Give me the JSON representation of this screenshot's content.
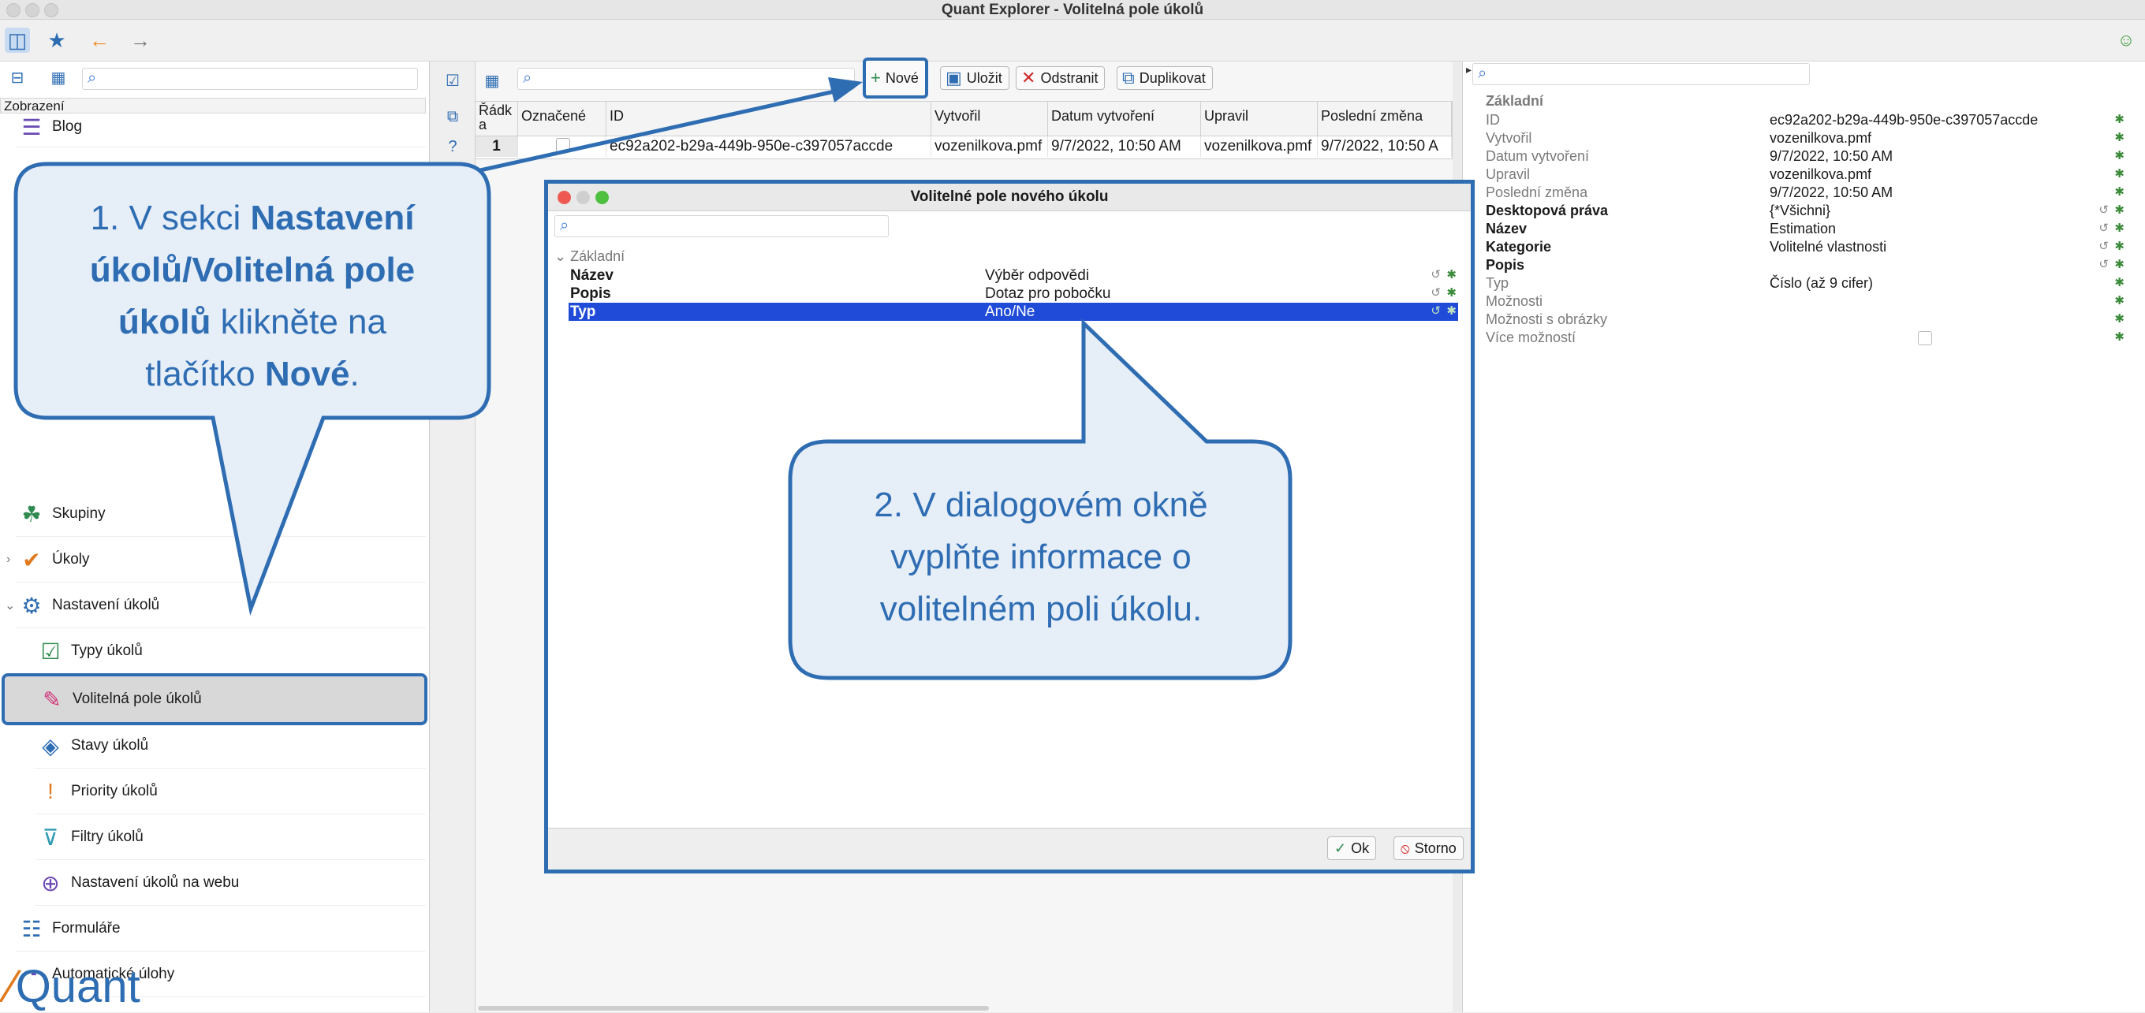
{
  "window": {
    "title": "Quant Explorer - Volitelná pole úkolů"
  },
  "sidebar": {
    "section_label": "Zobrazení",
    "items": [
      {
        "label": "Blog",
        "icon": "blog-icon"
      },
      {
        "label": "Skupiny",
        "icon": "groups-icon"
      },
      {
        "label": "Úkoly",
        "icon": "tasks-icon"
      },
      {
        "label": "Nastavení úkolů",
        "icon": "task-settings-icon"
      },
      {
        "label": "Typy úkolů",
        "icon": "task-types-icon"
      },
      {
        "label": "Volitelná pole úkolů",
        "icon": "custom-fields-icon"
      },
      {
        "label": "Stavy úkolů",
        "icon": "task-states-icon"
      },
      {
        "label": "Priority úkolů",
        "icon": "task-priorities-icon"
      },
      {
        "label": "Filtry úkolů",
        "icon": "task-filters-icon"
      },
      {
        "label": "Nastavení úkolů na webu",
        "icon": "web-task-settings-icon"
      },
      {
        "label": "Formuláře",
        "icon": "forms-icon"
      },
      {
        "label": "Automatické úlohy",
        "icon": "automatic-jobs-icon"
      }
    ],
    "logo_text": "Quant"
  },
  "toolbar": {
    "new_label": "Nové",
    "save_label": "Uložit",
    "delete_label": "Odstranit",
    "duplicate_label": "Duplikovat"
  },
  "grid": {
    "columns": [
      "Řádk a",
      "Označené",
      "ID",
      "Vytvořil",
      "Datum vytvoření",
      "Upravil",
      "Poslední změna"
    ],
    "rows": [
      [
        "1",
        "",
        "ec92a202-b29a-449b-950e-c397057accde",
        "vozenilkova.pmf",
        "9/7/2022, 10:50 AM",
        "vozenilkova.pmf",
        "9/7/2022, 10:50 A"
      ]
    ]
  },
  "properties": {
    "group": "Základní",
    "rows": [
      {
        "key": "ID",
        "value": "ec92a202-b29a-449b-950e-c397057accde"
      },
      {
        "key": "Vytvořil",
        "value": "vozenilkova.pmf"
      },
      {
        "key": "Datum vytvoření",
        "value": "9/7/2022, 10:50 AM"
      },
      {
        "key": "Upravil",
        "value": "vozenilkova.pmf"
      },
      {
        "key": "Poslední změna",
        "value": "9/7/2022, 10:50 AM"
      },
      {
        "key": "Desktopová práva",
        "value": "{*Všichni}"
      },
      {
        "key": "Název",
        "value": "Estimation"
      },
      {
        "key": "Kategorie",
        "value": "Volitelné vlastnosti"
      },
      {
        "key": "Popis",
        "value": ""
      },
      {
        "key": "Typ",
        "value": "Číslo (až 9 cifer)"
      },
      {
        "key": "Možnosti",
        "value": ""
      },
      {
        "key": "Možnosti s obrázky",
        "value": ""
      },
      {
        "key": "Více možností",
        "value": ""
      }
    ]
  },
  "dialog": {
    "title": "Volitelné pole nového úkolu",
    "group": "Základní",
    "rows": [
      {
        "key": "Název",
        "value": "Výběr odpovědi"
      },
      {
        "key": "Popis",
        "value": "Dotaz pro pobočku"
      },
      {
        "key": "Typ",
        "value": "Ano/Ne"
      }
    ],
    "ok_label": "Ok",
    "cancel_label": "Storno"
  },
  "callouts": {
    "one": {
      "line1_a": "1. V sekci ",
      "line1_b": "Nastavení",
      "line2": "úkolů/Volitelná pole",
      "line3_a": "úkolů",
      "line3_b": " klikněte na",
      "line4_a": "tlačítko ",
      "line4_b": "Nové",
      "line4_c": "."
    },
    "two": {
      "line1": "2. V dialogovém okně",
      "line2": "vyplňte informace o",
      "line3": "volitelném poli úkolu."
    }
  },
  "colors": {
    "accent": "#2f6db3",
    "callout_fill": "#e6eef8",
    "selection": "#1f4bd8"
  }
}
